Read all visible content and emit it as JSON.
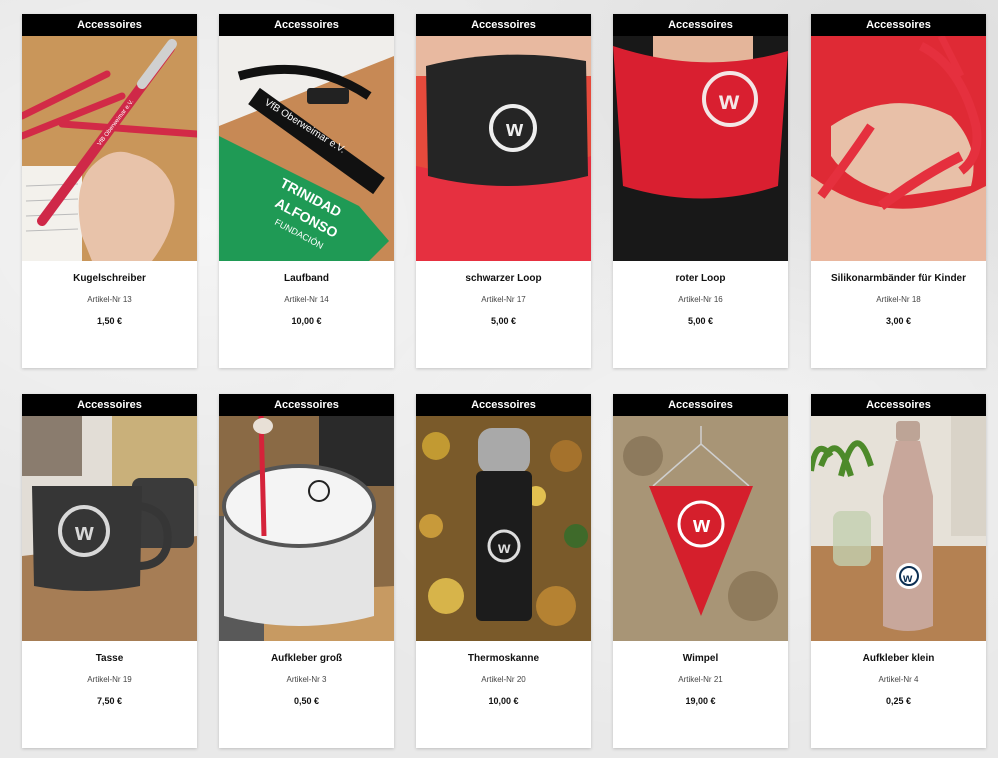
{
  "products": [
    {
      "category": "Accessoires",
      "name": "Kugelschreiber",
      "article": "Artikel-Nr 13",
      "price": "1,50 €",
      "image": "pen-photo"
    },
    {
      "category": "Accessoires",
      "name": "Laufband",
      "article": "Artikel-Nr 14",
      "price": "10,00 €",
      "image": "lanyard-photo"
    },
    {
      "category": "Accessoires",
      "name": "schwarzer Loop",
      "article": "Artikel-Nr 17",
      "price": "5,00 €",
      "image": "black-loop-photo"
    },
    {
      "category": "Accessoires",
      "name": "roter Loop",
      "article": "Artikel-Nr 16",
      "price": "5,00 €",
      "image": "red-loop-photo"
    },
    {
      "category": "Accessoires",
      "name": "Silikonarmbänder für Kinder",
      "article": "Artikel-Nr 18",
      "price": "3,00 €",
      "image": "wristband-photo"
    },
    {
      "category": "Accessoires",
      "name": "Tasse",
      "article": "Artikel-Nr 19",
      "price": "7,50 €",
      "image": "mug-photo"
    },
    {
      "category": "Accessoires",
      "name": "Aufkleber groß",
      "article": "Artikel-Nr 3",
      "price": "0,50 €",
      "image": "drum-sticker-photo"
    },
    {
      "category": "Accessoires",
      "name": "Thermoskanne",
      "article": "Artikel-Nr 20",
      "price": "10,00 €",
      "image": "thermos-photo"
    },
    {
      "category": "Accessoires",
      "name": "Wimpel",
      "article": "Artikel-Nr 21",
      "price": "19,00 €",
      "image": "pennant-photo"
    },
    {
      "category": "Accessoires",
      "name": "Aufkleber klein",
      "article": "Artikel-Nr 4",
      "price": "0,25 €",
      "image": "bottle-sticker-photo"
    }
  ],
  "image_text": {
    "pen_print": "VfB Oberweimar e.V.",
    "lanyard_print": "VfB Oberweimar e.V.",
    "flag_line1": "TRINIDAD",
    "flag_line2": "ALFONSO",
    "flag_line3": "FUNDACIÓN"
  },
  "colors": {
    "category_bar": "#000000",
    "card_background": "#ffffff",
    "club_red": "#d8202e",
    "page_background": "#e9e9e9"
  }
}
